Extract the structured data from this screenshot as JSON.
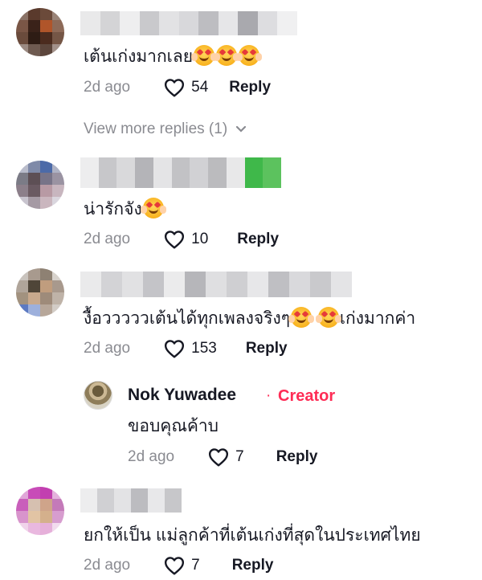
{
  "comments": [
    {
      "text": "เต้นเก่งมากเลย",
      "time": "2d ago",
      "likes": "54",
      "reply_label": "Reply",
      "emoji_count": 3
    },
    {
      "text": "น่ารักจัง",
      "time": "2d ago",
      "likes": "10",
      "reply_label": "Reply",
      "emoji_count": 1
    },
    {
      "text_before": "งื้อวววววเต้นได้ทุกเพลงจริงๆ",
      "text_after": "เก่งมากค่า",
      "time": "2d ago",
      "likes": "153",
      "reply_label": "Reply"
    },
    {
      "text": "ยกให้เป็น แม่ลูกค้าที่เต้นเก่งที่สุดในประเทศไทย",
      "time": "2d ago",
      "likes": "7",
      "reply_label": "Reply"
    }
  ],
  "view_more": "View more replies (1)",
  "creator_reply": {
    "name": "Nok Yuwadee",
    "separator": "·",
    "badge": "Creator",
    "text": "ขอบคุณค้าบ",
    "time": "2d ago",
    "likes": "7",
    "reply_label": "Reply"
  },
  "colors": {
    "accent": "#fe2c55",
    "muted": "#8a8b91",
    "text": "#161823"
  },
  "icons": [
    "heart-icon",
    "chevron-down-icon",
    "heart-eyes-emoji"
  ]
}
